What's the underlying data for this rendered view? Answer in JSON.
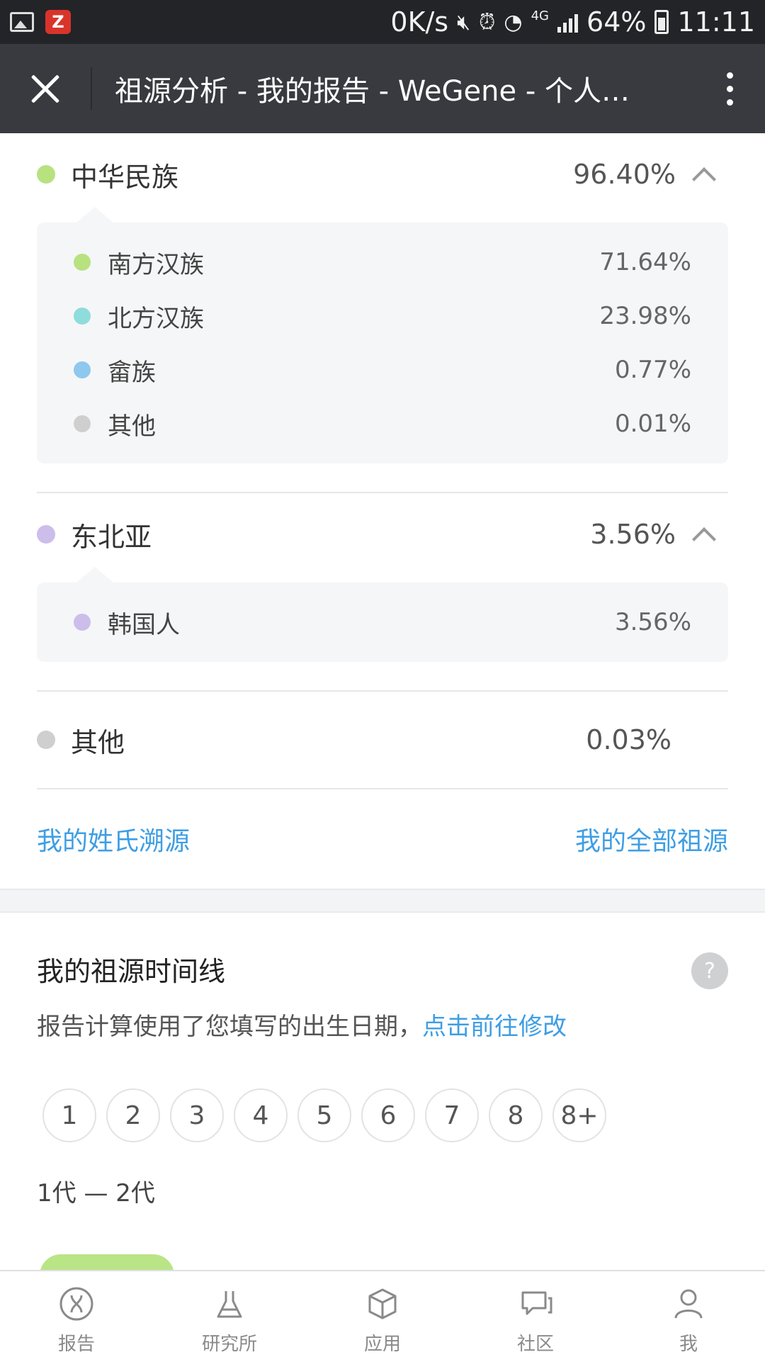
{
  "status_bar": {
    "net_speed": "0K/s",
    "network": "4G",
    "battery": "64%",
    "time": "11:11"
  },
  "title_bar": {
    "title": "祖源分析 - 我的报告 - WeGene - 个人…"
  },
  "groups": [
    {
      "name": "中华民族",
      "percent": "96.40%",
      "color": "#b7e27f",
      "expanded": true,
      "items": [
        {
          "name": "南方汉族",
          "percent": "71.64%",
          "color": "#b7e27f"
        },
        {
          "name": "北方汉族",
          "percent": "23.98%",
          "color": "#8fdcdc"
        },
        {
          "name": "畲族",
          "percent": "0.77%",
          "color": "#8ec8ef"
        },
        {
          "name": "其他",
          "percent": "0.01%",
          "color": "#cfcfcf"
        }
      ]
    },
    {
      "name": "东北亚",
      "percent": "3.56%",
      "color": "#cdbdea",
      "expanded": true,
      "items": [
        {
          "name": "韩国人",
          "percent": "3.56%",
          "color": "#cdbdea"
        }
      ]
    },
    {
      "name": "其他",
      "percent": "0.03%",
      "color": "#cfcfcf",
      "expanded": false,
      "items": []
    }
  ],
  "links": {
    "surname": "我的姓氏溯源",
    "all_ancestry": "我的全部祖源"
  },
  "timeline": {
    "title": "我的祖源时间线",
    "help": "?",
    "subtitle": "报告计算使用了您填写的出生日期，",
    "subtitle_link": "点击前往修改",
    "generations": [
      "1",
      "2",
      "3",
      "4",
      "5",
      "6",
      "7",
      "8",
      "8+"
    ],
    "range_label": "1代 — 2代"
  },
  "bottom_nav": [
    {
      "label": "报告",
      "icon": "dna-icon"
    },
    {
      "label": "研究所",
      "icon": "flask-icon"
    },
    {
      "label": "应用",
      "icon": "cube-icon"
    },
    {
      "label": "社区",
      "icon": "chat-icon"
    },
    {
      "label": "我",
      "icon": "user-icon"
    }
  ],
  "colors": {
    "accent_link": "#3e9ee4",
    "title_bar": "#393a3f",
    "status_bar": "#232427"
  }
}
